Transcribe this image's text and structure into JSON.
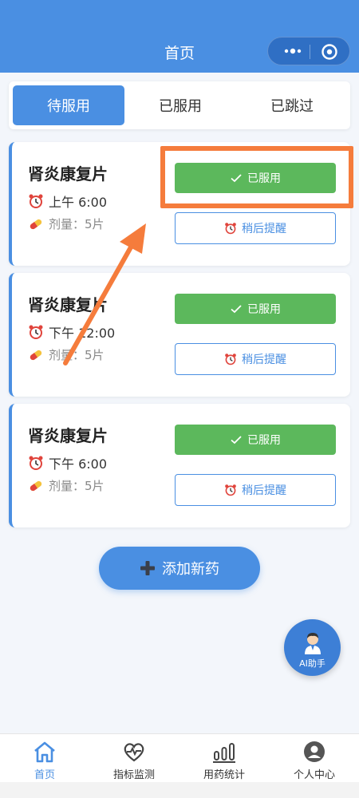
{
  "header": {
    "title": "首页"
  },
  "tabs": [
    {
      "label": "待服用",
      "active": true
    },
    {
      "label": "已服用",
      "active": false
    },
    {
      "label": "已跳过",
      "active": false
    }
  ],
  "medications": [
    {
      "name": "肾炎康复片",
      "time": "上午 6:00",
      "dose": "剂量：5片",
      "taken_label": "已服用",
      "later_label": "稍后提醒"
    },
    {
      "name": "肾炎康复片",
      "time": "下午 12:00",
      "dose": "剂量：5片",
      "taken_label": "已服用",
      "later_label": "稍后提醒"
    },
    {
      "name": "肾炎康复片",
      "time": "下午 6:00",
      "dose": "剂量：5片",
      "taken_label": "已服用",
      "later_label": "稍后提醒"
    }
  ],
  "add_button": {
    "label": "添加新药"
  },
  "ai_assistant": {
    "label": "AI助手"
  },
  "bottom_nav": [
    {
      "label": "首页",
      "icon": "home-icon",
      "active": true
    },
    {
      "label": "指标监测",
      "icon": "heart-pulse-icon",
      "active": false
    },
    {
      "label": "用药统计",
      "icon": "bar-chart-icon",
      "active": false
    },
    {
      "label": "个人中心",
      "icon": "user-icon",
      "active": false
    }
  ],
  "colors": {
    "primary": "#4a8fe2",
    "success": "#5cb85c",
    "annotation": "#f57c3c"
  }
}
